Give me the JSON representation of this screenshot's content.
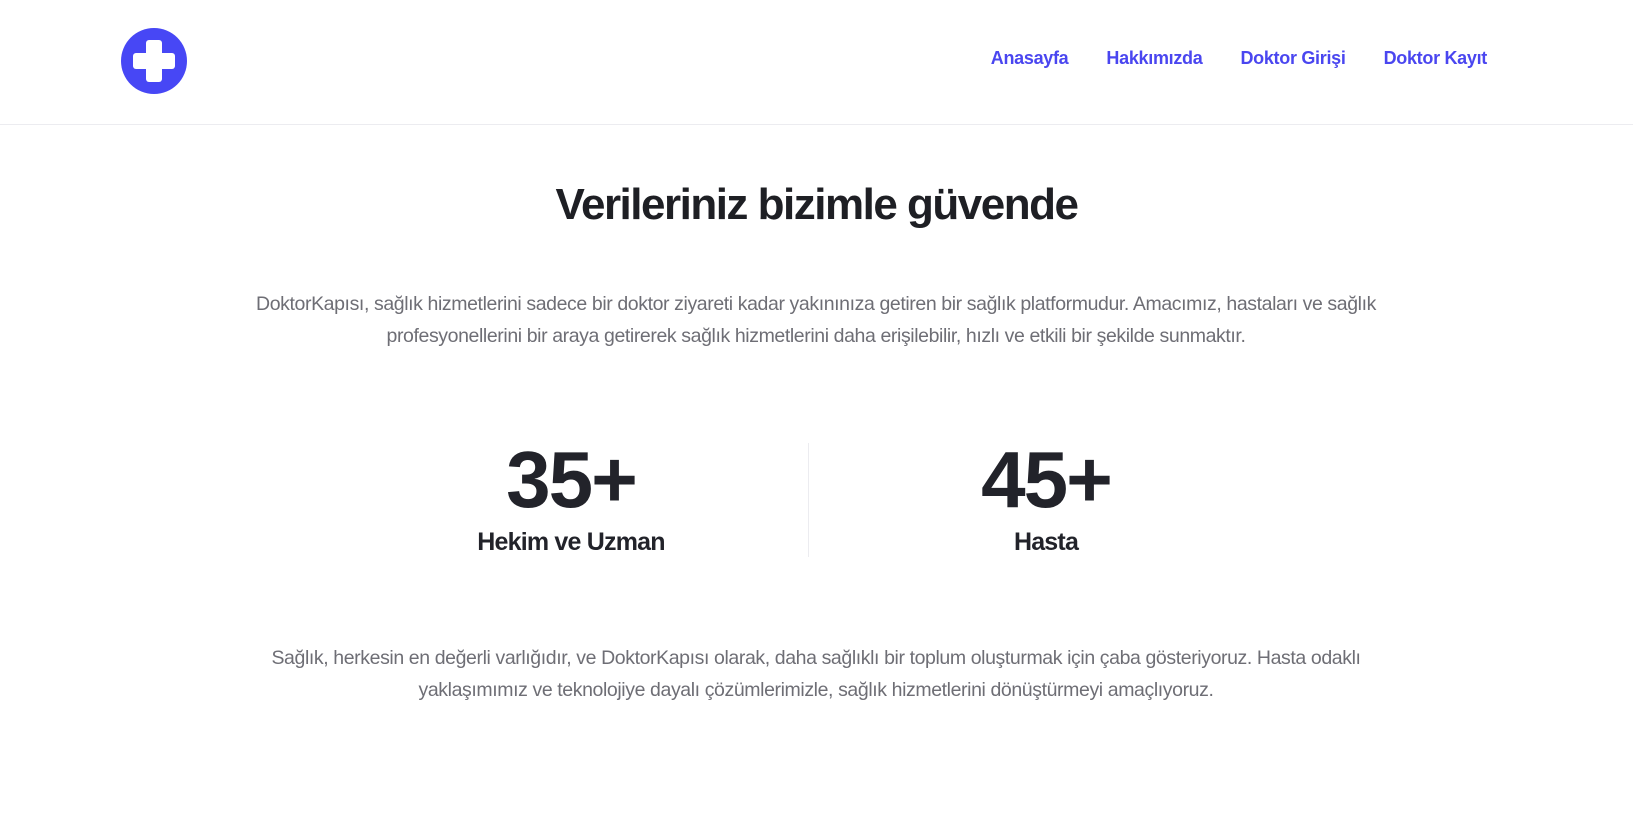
{
  "header": {
    "logo_icon": "medical-cross-icon",
    "brand_color": "#4747f5",
    "nav": [
      {
        "label": "Anasayfa"
      },
      {
        "label": "Hakkımızda"
      },
      {
        "label": "Doktor Girişi"
      },
      {
        "label": "Doktor Kayıt"
      }
    ]
  },
  "main": {
    "title": "Verileriniz bizimle güvende",
    "intro": "DoktorKapısı, sağlık hizmetlerini sadece bir doktor ziyareti kadar yakınınıza getiren bir sağlık platformudur. Amacımız, hastaları ve sağlık profesyonellerini bir araya getirerek sağlık hizmetlerini daha erişilebilir, hızlı ve etkili bir şekilde sunmaktır.",
    "stats": [
      {
        "value": "35+",
        "label": "Hekim ve Uzman"
      },
      {
        "value": "45+",
        "label": "Hasta"
      }
    ],
    "outro": "Sağlık, herkesin en değerli varlığıdır, ve DoktorKapısı olarak, daha sağlıklı bir toplum oluşturmak için çaba gösteriyoruz. Hasta odaklı yaklaşımımız ve teknolojiye dayalı çözümlerimizle, sağlık hizmetlerini dönüştürmeyi amaçlıyoruz."
  }
}
